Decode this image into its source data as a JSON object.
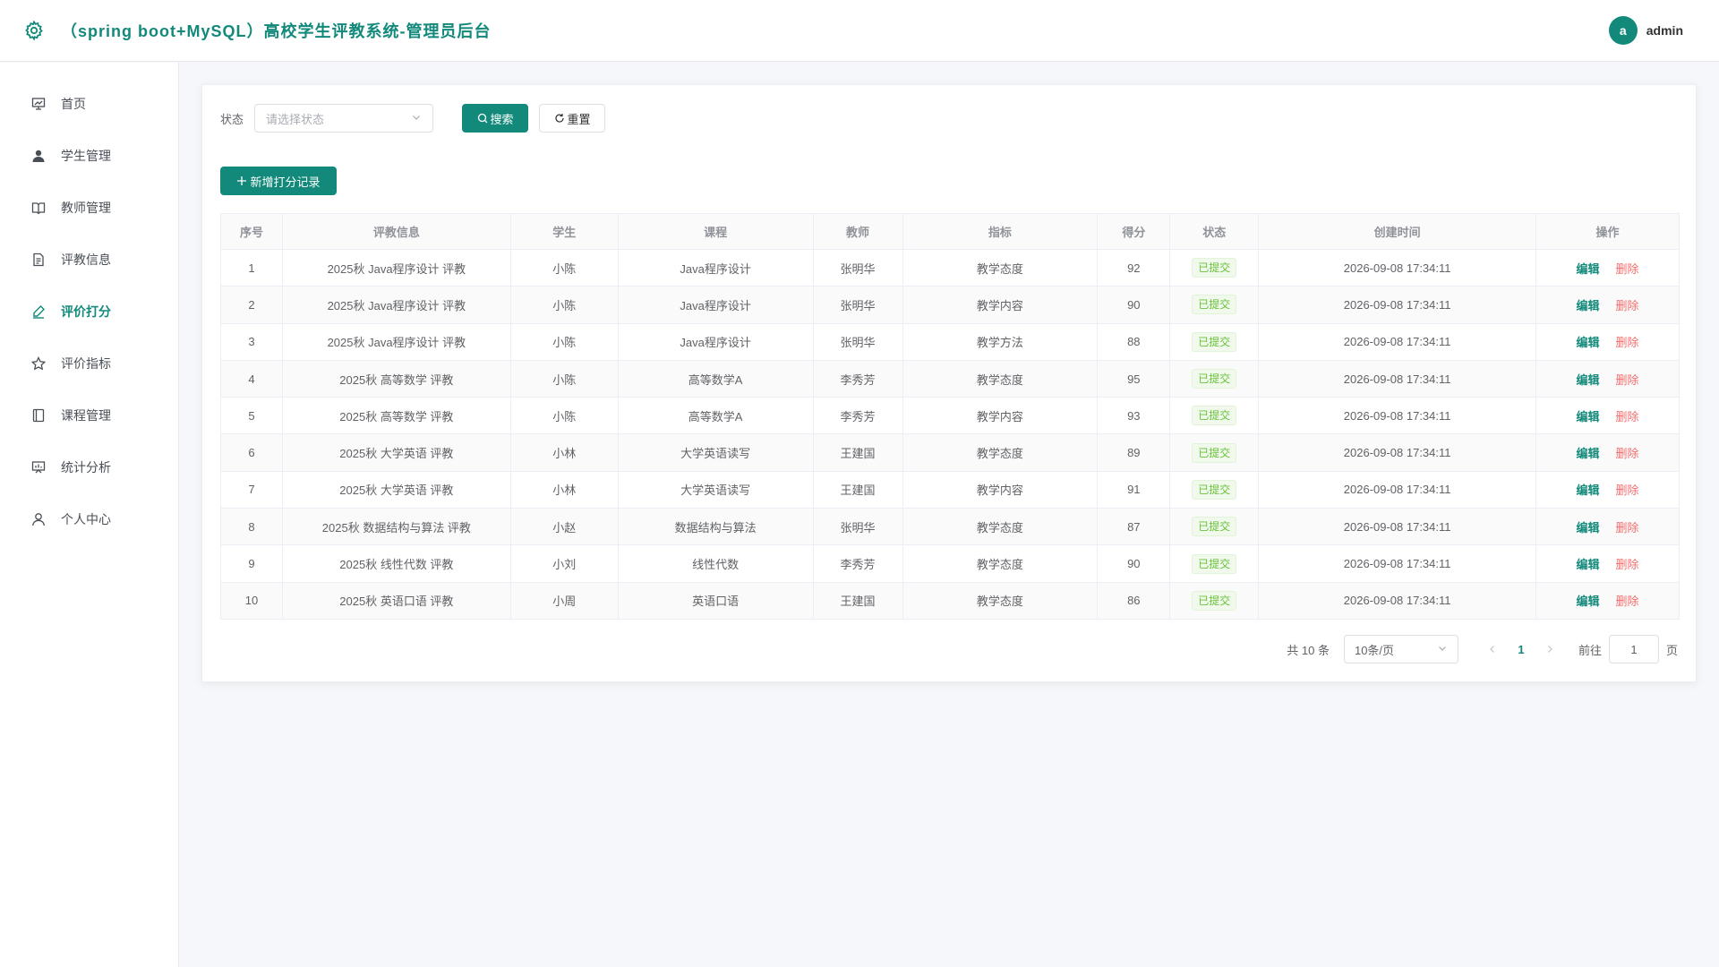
{
  "header": {
    "title": "（spring boot+MySQL）高校学生评教系统-管理员后台",
    "avatar_letter": "a",
    "username": "admin",
    "accent_color": "#12897a"
  },
  "sidebar": {
    "items": [
      {
        "label": "首页",
        "icon": "presentation-icon"
      },
      {
        "label": "学生管理",
        "icon": "user-icon"
      },
      {
        "label": "教师管理",
        "icon": "book-icon"
      },
      {
        "label": "评教信息",
        "icon": "document-icon"
      },
      {
        "label": "评价打分",
        "icon": "pen-icon",
        "active": true
      },
      {
        "label": "评价指标",
        "icon": "star-icon"
      },
      {
        "label": "课程管理",
        "icon": "notebook-icon"
      },
      {
        "label": "统计分析",
        "icon": "chart-board-icon"
      },
      {
        "label": "个人中心",
        "icon": "user-outline-icon"
      }
    ]
  },
  "filter": {
    "status_label": "状态",
    "status_placeholder": "请选择状态",
    "search_label": "搜索",
    "reset_label": "重置"
  },
  "add_button_label": "新增打分记录",
  "table": {
    "columns": [
      "序号",
      "评教信息",
      "学生",
      "课程",
      "教师",
      "指标",
      "得分",
      "状态",
      "创建时间",
      "操作"
    ],
    "edit_label": "编辑",
    "delete_label": "删除",
    "rows": [
      {
        "no": "1",
        "info": "2025秋 Java程序设计 评教",
        "student": "小陈",
        "course": "Java程序设计",
        "teacher": "张明华",
        "indicator": "教学态度",
        "score": "92",
        "status": "已提交",
        "created": "2026-09-08 17:34:11"
      },
      {
        "no": "2",
        "info": "2025秋 Java程序设计 评教",
        "student": "小陈",
        "course": "Java程序设计",
        "teacher": "张明华",
        "indicator": "教学内容",
        "score": "90",
        "status": "已提交",
        "created": "2026-09-08 17:34:11"
      },
      {
        "no": "3",
        "info": "2025秋 Java程序设计 评教",
        "student": "小陈",
        "course": "Java程序设计",
        "teacher": "张明华",
        "indicator": "教学方法",
        "score": "88",
        "status": "已提交",
        "created": "2026-09-08 17:34:11"
      },
      {
        "no": "4",
        "info": "2025秋 高等数学 评教",
        "student": "小陈",
        "course": "高等数学A",
        "teacher": "李秀芳",
        "indicator": "教学态度",
        "score": "95",
        "status": "已提交",
        "created": "2026-09-08 17:34:11"
      },
      {
        "no": "5",
        "info": "2025秋 高等数学 评教",
        "student": "小陈",
        "course": "高等数学A",
        "teacher": "李秀芳",
        "indicator": "教学内容",
        "score": "93",
        "status": "已提交",
        "created": "2026-09-08 17:34:11"
      },
      {
        "no": "6",
        "info": "2025秋 大学英语 评教",
        "student": "小林",
        "course": "大学英语读写",
        "teacher": "王建国",
        "indicator": "教学态度",
        "score": "89",
        "status": "已提交",
        "created": "2026-09-08 17:34:11"
      },
      {
        "no": "7",
        "info": "2025秋 大学英语 评教",
        "student": "小林",
        "course": "大学英语读写",
        "teacher": "王建国",
        "indicator": "教学内容",
        "score": "91",
        "status": "已提交",
        "created": "2026-09-08 17:34:11"
      },
      {
        "no": "8",
        "info": "2025秋 数据结构与算法 评教",
        "student": "小赵",
        "course": "数据结构与算法",
        "teacher": "张明华",
        "indicator": "教学态度",
        "score": "87",
        "status": "已提交",
        "created": "2026-09-08 17:34:11"
      },
      {
        "no": "9",
        "info": "2025秋 线性代数 评教",
        "student": "小刘",
        "course": "线性代数",
        "teacher": "李秀芳",
        "indicator": "教学态度",
        "score": "90",
        "status": "已提交",
        "created": "2026-09-08 17:34:11"
      },
      {
        "no": "10",
        "info": "2025秋 英语口语 评教",
        "student": "小周",
        "course": "英语口语",
        "teacher": "王建国",
        "indicator": "教学态度",
        "score": "86",
        "status": "已提交",
        "created": "2026-09-08 17:34:11"
      }
    ]
  },
  "pagination": {
    "total_text": "共 10 条",
    "page_size": "10条/页",
    "current_page": "1",
    "goto_label": "前往",
    "goto_value": "1",
    "page_unit": "页"
  }
}
